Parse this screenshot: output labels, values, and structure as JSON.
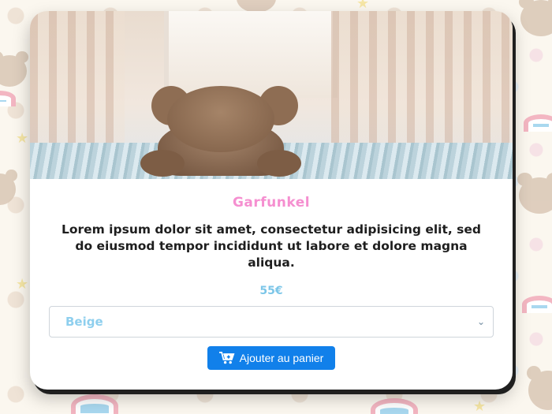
{
  "product": {
    "name": "Garfunkel",
    "description": "Lorem ipsum dolor sit amet, consectetur adipisicing elit, sed do eiusmod tempor incididunt ut labore et dolore magna aliqua.",
    "price": "55€",
    "color_select": {
      "selected": "Beige",
      "icon": "chevron-down-icon"
    },
    "add_to_cart_label": "Ajouter au panier",
    "add_to_cart_icon": "shopping-cart-icon"
  },
  "colors": {
    "name": "#f58fd0",
    "price": "#7cc6e8",
    "select_text": "#8ecfee",
    "button": "#1180ea"
  }
}
